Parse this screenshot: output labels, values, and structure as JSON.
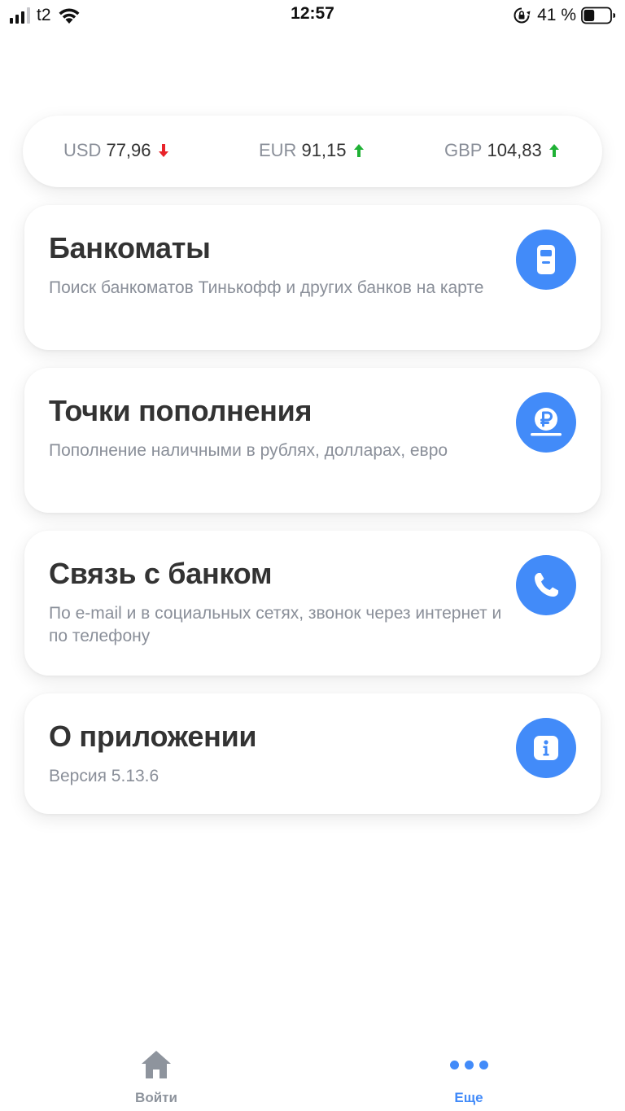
{
  "status_bar": {
    "carrier": "t2",
    "time": "12:57",
    "battery_percent": "41 %",
    "battery_level": 0.41,
    "signal_bars_active": 3,
    "signal_bars_total": 4
  },
  "rates": [
    {
      "code": "USD",
      "value": "77,96",
      "trend": "down",
      "trend_color": "#e8232a"
    },
    {
      "code": "EUR",
      "value": "91,15",
      "trend": "up",
      "trend_color": "#1fb135"
    },
    {
      "code": "GBP",
      "value": "104,83",
      "trend": "up",
      "trend_color": "#1fb135"
    }
  ],
  "menu": [
    {
      "title": "Банкоматы",
      "subtitle": "Поиск банкоматов Тинькофф и других банков на карте",
      "icon": "atm-icon"
    },
    {
      "title": "Точки пополнения",
      "subtitle": "Пополнение наличными в рублях, долларах, евро",
      "icon": "ruble-coin-icon"
    },
    {
      "title": "Связь с банком",
      "subtitle": "По e-mail и в социальных сетях, звонок через интернет и по телефону",
      "icon": "phone-icon"
    },
    {
      "title": "О приложении",
      "subtitle": "Версия 5.13.6",
      "icon": "info-icon"
    }
  ],
  "tab_bar": {
    "login_label": "Войти",
    "more_label": "Еще",
    "active_tab": "more"
  },
  "colors": {
    "accent": "#428bf9",
    "text_primary": "#333333",
    "text_secondary": "#8a8f99"
  }
}
